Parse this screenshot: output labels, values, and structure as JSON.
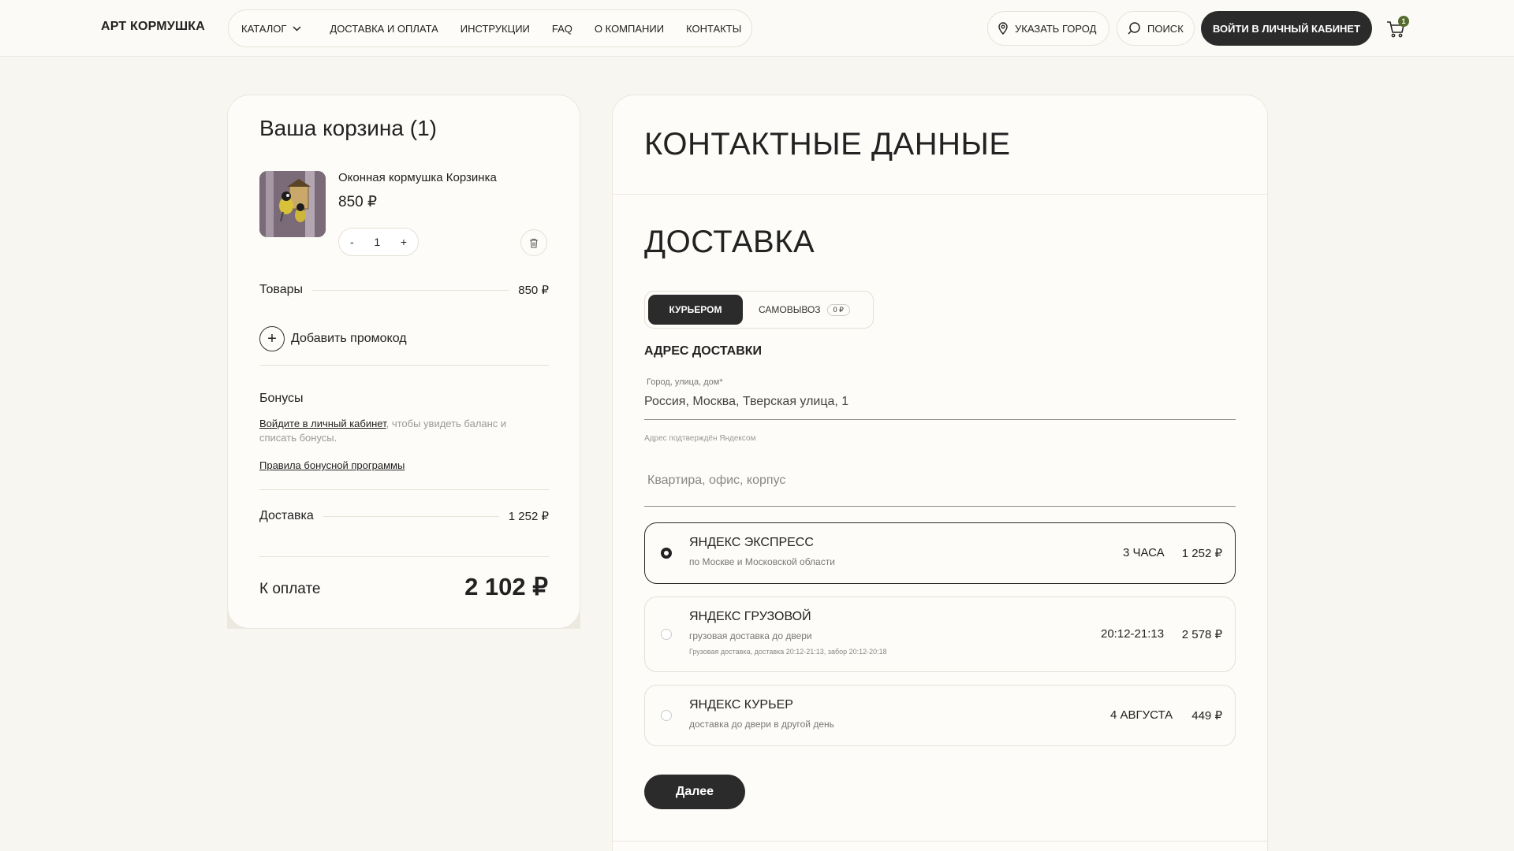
{
  "header": {
    "logo": "АРТ КОРМУШКА",
    "nav": [
      "КАТАЛОГ",
      "ДОСТАВКА И ОПЛАТА",
      "ИНСТРУКЦИИ",
      "FAQ",
      "О КОМПАНИИ",
      "КОНТАКТЫ"
    ],
    "city_label": "УКАЗАТЬ ГОРОД",
    "search_label": "ПОИСК",
    "login_label": "ВОЙТИ В ЛИЧНЫЙ КАБИНЕТ",
    "cart_count": "1"
  },
  "cart": {
    "title": "Ваша корзина (1)",
    "product": {
      "name": "Оконная кормушка Корзинка",
      "price": "850 ₽",
      "qty": "1",
      "minus": "-",
      "plus": "+"
    },
    "goods_label": "Товары",
    "goods_value": "850 ₽",
    "promo_label": "Добавить промокод",
    "bonus_title": "Бонусы",
    "bonus_link": "Войдите в личный кабинет",
    "bonus_text": ", чтобы увидеть баланс и списать бонусы.",
    "bonus_rules": "Правила бонусной программы",
    "delivery_label": "Доставка",
    "delivery_value": "1 252 ₽",
    "total_label": "К оплате",
    "total_value": "2 102 ₽"
  },
  "checkout": {
    "contacts_title": "КОНТАКТНЫЕ ДАННЫЕ",
    "delivery_title": "ДОСТАВКА",
    "tab_courier": "КУРЬЕРОМ",
    "tab_pickup": "САМОВЫВОЗ",
    "tab_pickup_badge": "0 ₽",
    "address_title": "АДРЕС ДОСТАВКИ",
    "address_label": "Город, улица, дом*",
    "address_value": "Россия, Москва, Тверская улица, 1",
    "address_hint": "Адрес подтверждён Яндексом",
    "apt_placeholder": "Квартира, офис, корпус",
    "options": [
      {
        "title": "ЯНДЕКС ЭКСПРЕСС",
        "sub": "по Москве и Московской области",
        "note": "",
        "time": "3 ЧАСА",
        "price": "1 252 ₽",
        "selected": true
      },
      {
        "title": "ЯНДЕКС ГРУЗОВОЙ",
        "sub": "грузовая доставка до двери",
        "note": "Грузовая доставка, доставка 20:12-21:13, забор 20:12-20:18",
        "time": "20:12-21:13",
        "price": "2 578 ₽",
        "selected": false
      },
      {
        "title": "ЯНДЕКС КУРЬЕР",
        "sub": "доставка до двери в другой день",
        "note": "",
        "time": "4 АВГУСТА",
        "price": "449 ₽",
        "selected": false
      }
    ],
    "next_label": "Далее"
  }
}
